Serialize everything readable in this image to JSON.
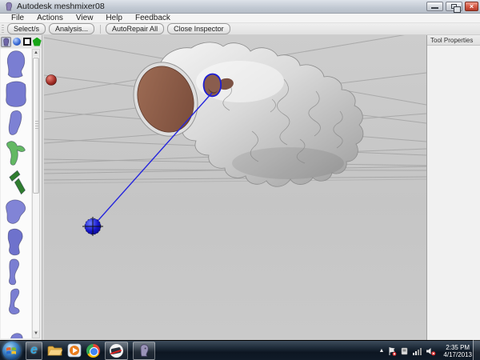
{
  "window": {
    "title": "Autodesk meshmixer08",
    "app_icon": "meshmixer-head",
    "controls": [
      "minimize",
      "restore",
      "close"
    ]
  },
  "menu_bar": {
    "items": [
      "File",
      "Actions",
      "View",
      "Help",
      "Feedback"
    ]
  },
  "toolbar": {
    "buttons": [
      "Select/s",
      "Analysis...",
      "AutoRepair All",
      "Close Inspector"
    ]
  },
  "sidebar": {
    "mode_icons": [
      "head-part-tool",
      "sphere-tool",
      "plane-tool",
      "polygon-tool"
    ],
    "thumbnails": [
      {
        "name": "head-part",
        "color": "#7a7ed2"
      },
      {
        "name": "face-part",
        "color": "#767ad0"
      },
      {
        "name": "ear-part",
        "color": "#7d81d4"
      },
      {
        "name": "branch-part",
        "color": "#63b863"
      },
      {
        "name": "sticks-part",
        "color": "#2f7d2f"
      },
      {
        "name": "blob-part",
        "color": "#8184d6"
      },
      {
        "name": "torso-part",
        "color": "#6e72cc"
      },
      {
        "name": "limb-part",
        "color": "#7a7ed2"
      },
      {
        "name": "foot-part",
        "color": "#7superseded"
      },
      {
        "name": "small-part",
        "color": "#7a7ed2"
      }
    ]
  },
  "right_panel": {
    "title": "Tool Properties"
  },
  "scene": {
    "objects": [
      "rocky-mesh",
      "brown-cap",
      "defect-selection",
      "pin-line",
      "blue-handle-sphere",
      "red-handle-sphere",
      "ground-grid"
    ],
    "colors": {
      "selection_outline": "#1d1dd6",
      "pin_line": "#2525dd",
      "blue_sphere": "#1414c8",
      "red_sphere": "#9e2b24",
      "mesh_cap_brown": "#8f604c",
      "viewport_bg": "#c7c7c7"
    }
  },
  "taskbar": {
    "icons": [
      "start-orb",
      "internet-explorer",
      "windows-explorer",
      "windows-media-player",
      "chrome",
      "game-app",
      "meshmixer-app"
    ],
    "tray_icons": [
      "show-hidden-icons",
      "action-center-flag-alert",
      "device-icon",
      "network-signal",
      "volume-muted"
    ],
    "time": "2:35 PM",
    "date": "4/17/2013"
  }
}
